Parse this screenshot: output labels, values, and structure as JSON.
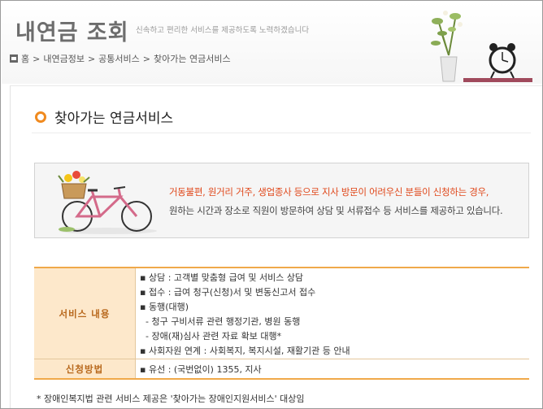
{
  "header": {
    "title": "내연금 조회",
    "subtitle": "신속하고 편리한 서비스를 제공하도록 노력하겠습니다",
    "breadcrumb": [
      "홈",
      "내연금정보",
      "공통서비스",
      "찾아가는 연금서비스"
    ]
  },
  "section": {
    "title": "찾아가는 연금서비스"
  },
  "info": {
    "line1": "거동불편, 원거리 거주, 생업종사 등으로 지사 방문이 어려우신 분들이 신청하는 경우,",
    "line2": "원하는 시간과 장소로 직원이 방문하여 상담 및 서류접수 등 서비스를 제공하고 있습니다."
  },
  "table": {
    "rows": [
      {
        "header": "서비스 내용",
        "items": [
          "▪ 상담 : 고객별 맞춤형 급여 및 서비스 상담",
          "▪ 접수 : 급여 청구(신청)서 및 변동신고서 접수",
          "▪ 동행(대행)",
          "  - 청구 구비서류 관련 행정기관, 병원 동행",
          "  - 장애(재)심사 관련 자료 확보 대행*",
          "▪ 사회자원 연계 : 사회복지, 복지시설, 재활기관 등 안내"
        ]
      },
      {
        "header": "신청방법",
        "items": [
          "▪ 유선 : (국번없이) 1355, 지사"
        ]
      }
    ]
  },
  "footnote": "* 장애인복지법 관련 서비스 제공은 '찾아가는 장애인지원서비스' 대상임",
  "colors": {
    "accent": "#f08a1f",
    "highlight_text": "#e0481b",
    "table_header_bg": "#fde8cb"
  },
  "icons": [
    "home-icon",
    "ring-bullet-icon",
    "plant-clock-decoration",
    "bicycle-illustration"
  ]
}
